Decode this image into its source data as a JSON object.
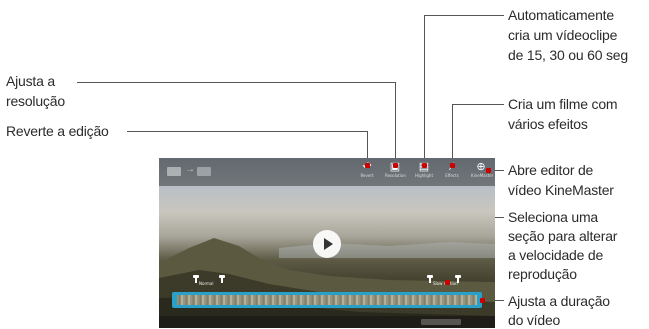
{
  "annotations": {
    "auto_clip": [
      "Automaticamente",
      "cria um vídeoclipe",
      "de 15, 30 ou 60 seg"
    ],
    "resolution": [
      "Ajusta a",
      "resolução"
    ],
    "revert": "Reverte a edição",
    "effects_movie": [
      "Cria um filme com",
      "vários efeitos"
    ],
    "kinemaster": [
      "Abre editor de",
      "vídeo KineMaster"
    ],
    "speed_section": [
      "Seleciona uma",
      "seção para alterar",
      "a velocidade de",
      "reprodução"
    ],
    "duration": [
      "Ajusta a duração",
      "do vídeo"
    ]
  },
  "editor": {
    "toolbar": {
      "revert_label": "Revert",
      "resolution_label": "Resolution",
      "highlight_label": "Highlight",
      "effects_label": "Effects",
      "kinemaster_label": "KineMaster"
    },
    "speed_label_left": "Normal",
    "speed_label_right": "Slow motion",
    "icons": [
      "revert-icon",
      "resolution-icon",
      "highlight-icon",
      "magic-wand-icon",
      "kinemaster-icon",
      "play-icon"
    ]
  },
  "colors": {
    "trim_accent": "#29a0c8",
    "marker": "#cc0000"
  }
}
